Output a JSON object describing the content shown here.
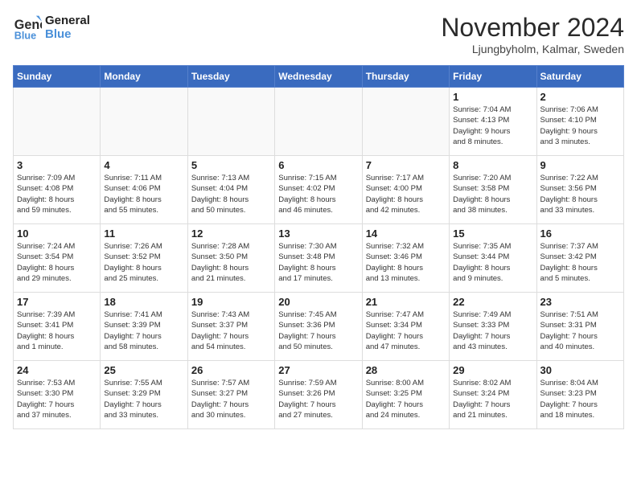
{
  "logo": {
    "line1": "General",
    "line2": "Blue"
  },
  "title": "November 2024",
  "location": "Ljungbyholm, Kalmar, Sweden",
  "weekdays": [
    "Sunday",
    "Monday",
    "Tuesday",
    "Wednesday",
    "Thursday",
    "Friday",
    "Saturday"
  ],
  "weeks": [
    [
      {
        "day": "",
        "info": ""
      },
      {
        "day": "",
        "info": ""
      },
      {
        "day": "",
        "info": ""
      },
      {
        "day": "",
        "info": ""
      },
      {
        "day": "",
        "info": ""
      },
      {
        "day": "1",
        "info": "Sunrise: 7:04 AM\nSunset: 4:13 PM\nDaylight: 9 hours\nand 8 minutes."
      },
      {
        "day": "2",
        "info": "Sunrise: 7:06 AM\nSunset: 4:10 PM\nDaylight: 9 hours\nand 3 minutes."
      }
    ],
    [
      {
        "day": "3",
        "info": "Sunrise: 7:09 AM\nSunset: 4:08 PM\nDaylight: 8 hours\nand 59 minutes."
      },
      {
        "day": "4",
        "info": "Sunrise: 7:11 AM\nSunset: 4:06 PM\nDaylight: 8 hours\nand 55 minutes."
      },
      {
        "day": "5",
        "info": "Sunrise: 7:13 AM\nSunset: 4:04 PM\nDaylight: 8 hours\nand 50 minutes."
      },
      {
        "day": "6",
        "info": "Sunrise: 7:15 AM\nSunset: 4:02 PM\nDaylight: 8 hours\nand 46 minutes."
      },
      {
        "day": "7",
        "info": "Sunrise: 7:17 AM\nSunset: 4:00 PM\nDaylight: 8 hours\nand 42 minutes."
      },
      {
        "day": "8",
        "info": "Sunrise: 7:20 AM\nSunset: 3:58 PM\nDaylight: 8 hours\nand 38 minutes."
      },
      {
        "day": "9",
        "info": "Sunrise: 7:22 AM\nSunset: 3:56 PM\nDaylight: 8 hours\nand 33 minutes."
      }
    ],
    [
      {
        "day": "10",
        "info": "Sunrise: 7:24 AM\nSunset: 3:54 PM\nDaylight: 8 hours\nand 29 minutes."
      },
      {
        "day": "11",
        "info": "Sunrise: 7:26 AM\nSunset: 3:52 PM\nDaylight: 8 hours\nand 25 minutes."
      },
      {
        "day": "12",
        "info": "Sunrise: 7:28 AM\nSunset: 3:50 PM\nDaylight: 8 hours\nand 21 minutes."
      },
      {
        "day": "13",
        "info": "Sunrise: 7:30 AM\nSunset: 3:48 PM\nDaylight: 8 hours\nand 17 minutes."
      },
      {
        "day": "14",
        "info": "Sunrise: 7:32 AM\nSunset: 3:46 PM\nDaylight: 8 hours\nand 13 minutes."
      },
      {
        "day": "15",
        "info": "Sunrise: 7:35 AM\nSunset: 3:44 PM\nDaylight: 8 hours\nand 9 minutes."
      },
      {
        "day": "16",
        "info": "Sunrise: 7:37 AM\nSunset: 3:42 PM\nDaylight: 8 hours\nand 5 minutes."
      }
    ],
    [
      {
        "day": "17",
        "info": "Sunrise: 7:39 AM\nSunset: 3:41 PM\nDaylight: 8 hours\nand 1 minute."
      },
      {
        "day": "18",
        "info": "Sunrise: 7:41 AM\nSunset: 3:39 PM\nDaylight: 7 hours\nand 58 minutes."
      },
      {
        "day": "19",
        "info": "Sunrise: 7:43 AM\nSunset: 3:37 PM\nDaylight: 7 hours\nand 54 minutes."
      },
      {
        "day": "20",
        "info": "Sunrise: 7:45 AM\nSunset: 3:36 PM\nDaylight: 7 hours\nand 50 minutes."
      },
      {
        "day": "21",
        "info": "Sunrise: 7:47 AM\nSunset: 3:34 PM\nDaylight: 7 hours\nand 47 minutes."
      },
      {
        "day": "22",
        "info": "Sunrise: 7:49 AM\nSunset: 3:33 PM\nDaylight: 7 hours\nand 43 minutes."
      },
      {
        "day": "23",
        "info": "Sunrise: 7:51 AM\nSunset: 3:31 PM\nDaylight: 7 hours\nand 40 minutes."
      }
    ],
    [
      {
        "day": "24",
        "info": "Sunrise: 7:53 AM\nSunset: 3:30 PM\nDaylight: 7 hours\nand 37 minutes."
      },
      {
        "day": "25",
        "info": "Sunrise: 7:55 AM\nSunset: 3:29 PM\nDaylight: 7 hours\nand 33 minutes."
      },
      {
        "day": "26",
        "info": "Sunrise: 7:57 AM\nSunset: 3:27 PM\nDaylight: 7 hours\nand 30 minutes."
      },
      {
        "day": "27",
        "info": "Sunrise: 7:59 AM\nSunset: 3:26 PM\nDaylight: 7 hours\nand 27 minutes."
      },
      {
        "day": "28",
        "info": "Sunrise: 8:00 AM\nSunset: 3:25 PM\nDaylight: 7 hours\nand 24 minutes."
      },
      {
        "day": "29",
        "info": "Sunrise: 8:02 AM\nSunset: 3:24 PM\nDaylight: 7 hours\nand 21 minutes."
      },
      {
        "day": "30",
        "info": "Sunrise: 8:04 AM\nSunset: 3:23 PM\nDaylight: 7 hours\nand 18 minutes."
      }
    ]
  ]
}
